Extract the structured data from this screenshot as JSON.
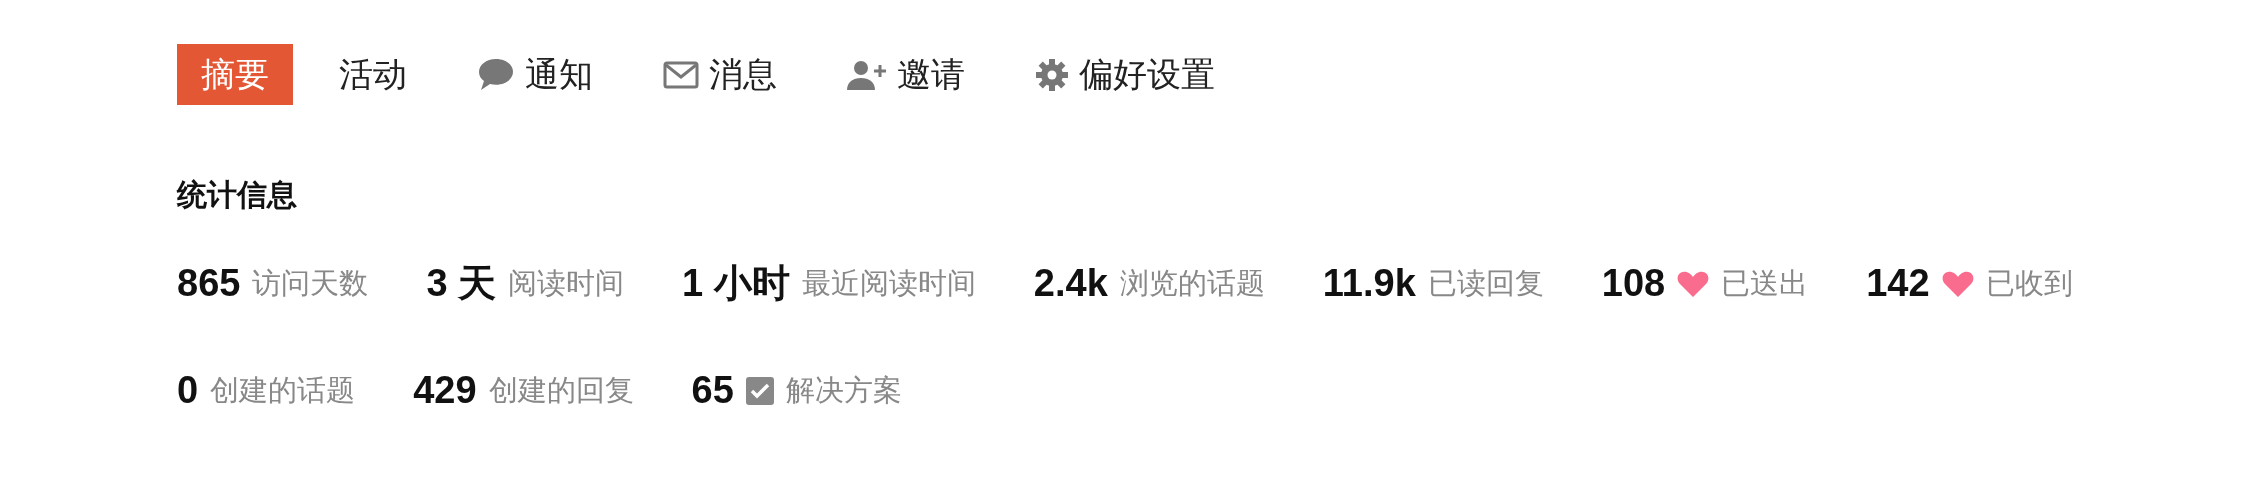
{
  "nav": [
    {
      "label": "摘要",
      "kind": "plain",
      "selected": true
    },
    {
      "label": "活动",
      "kind": "plain",
      "selected": false
    },
    {
      "label": "通知",
      "kind": "bubble",
      "selected": false
    },
    {
      "label": "消息",
      "kind": "mail",
      "selected": false
    },
    {
      "label": "邀请",
      "kind": "user-plus",
      "selected": false
    },
    {
      "label": "偏好设置",
      "kind": "gear",
      "selected": false
    }
  ],
  "stats": {
    "title": "统计信息",
    "rows": [
      [
        {
          "value": "865",
          "label": "访问天数",
          "kind": "plain"
        },
        {
          "value": "3 天",
          "label": "阅读时间",
          "kind": "plain"
        },
        {
          "value": "1 小时",
          "label": "最近阅读时间",
          "kind": "plain"
        },
        {
          "value": "2.4k",
          "label": "浏览的话题",
          "kind": "plain"
        },
        {
          "value": "11.9k",
          "label": "已读回复",
          "kind": "plain"
        },
        {
          "value": "108",
          "label": "已送出",
          "kind": "heart"
        },
        {
          "value": "142",
          "label": "已收到",
          "kind": "heart"
        }
      ],
      [
        {
          "value": "0",
          "label": "创建的话题",
          "kind": "plain"
        },
        {
          "value": "429",
          "label": "创建的回复",
          "kind": "plain"
        },
        {
          "value": "65",
          "label": "解决方案",
          "kind": "check"
        }
      ]
    ]
  }
}
